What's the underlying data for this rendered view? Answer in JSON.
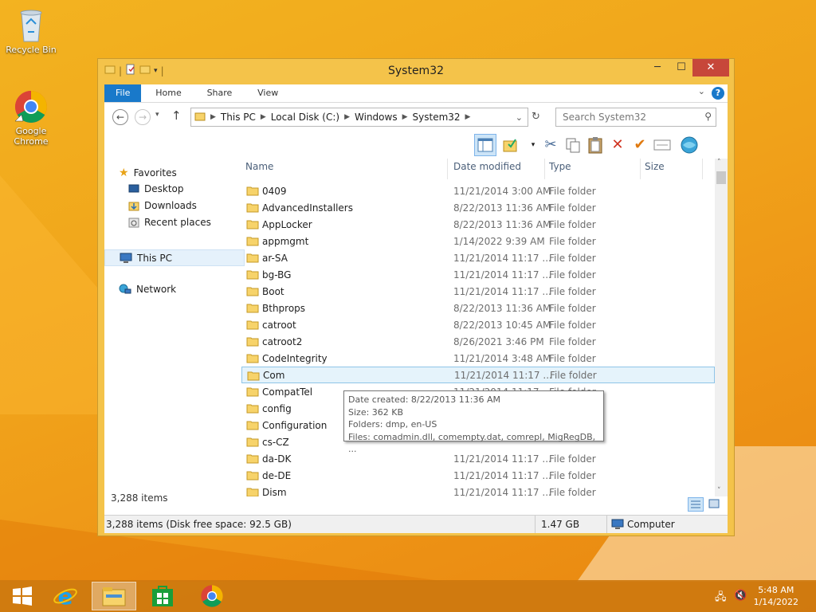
{
  "desktop": {
    "icons": [
      {
        "label": "Recycle Bin",
        "icon": "recycle-bin-icon"
      },
      {
        "label": "Google Chrome",
        "icon": "chrome-icon"
      }
    ]
  },
  "window": {
    "title": "System32",
    "controls": {
      "minimize": "─",
      "maximize": "☐",
      "close": "✕"
    },
    "ribbon_tabs": [
      {
        "label": "File",
        "active": true
      },
      {
        "label": "Home"
      },
      {
        "label": "Share"
      },
      {
        "label": "View"
      }
    ],
    "help_label": "?",
    "address": {
      "crumbs": [
        "This PC",
        "Local Disk (C:)",
        "Windows",
        "System32"
      ]
    },
    "search": {
      "placeholder": "Search System32"
    },
    "toolbar": [
      "preview-pane-icon",
      "folder-options-icon",
      "cut-icon",
      "copy-icon",
      "paste-icon",
      "delete-icon",
      "rename-icon",
      "properties-icon",
      "globe-icon"
    ],
    "navigation": {
      "favorites": "Favorites",
      "items": [
        "Desktop",
        "Downloads",
        "Recent places"
      ],
      "this_pc": "This PC",
      "network": "Network"
    },
    "columns": {
      "name": "Name",
      "date": "Date modified",
      "type": "Type",
      "size": "Size"
    },
    "files": [
      {
        "name": "0409",
        "date": "11/21/2014 3:00 AM",
        "type": "File folder"
      },
      {
        "name": "AdvancedInstallers",
        "date": "8/22/2013 11:36 AM",
        "type": "File folder"
      },
      {
        "name": "AppLocker",
        "date": "8/22/2013 11:36 AM",
        "type": "File folder"
      },
      {
        "name": "appmgmt",
        "date": "1/14/2022 9:39 AM",
        "type": "File folder"
      },
      {
        "name": "ar-SA",
        "date": "11/21/2014 11:17 ...",
        "type": "File folder"
      },
      {
        "name": "bg-BG",
        "date": "11/21/2014 11:17 ...",
        "type": "File folder"
      },
      {
        "name": "Boot",
        "date": "11/21/2014 11:17 ...",
        "type": "File folder"
      },
      {
        "name": "Bthprops",
        "date": "8/22/2013 11:36 AM",
        "type": "File folder"
      },
      {
        "name": "catroot",
        "date": "8/22/2013 10:45 AM",
        "type": "File folder"
      },
      {
        "name": "catroot2",
        "date": "8/26/2021 3:46 PM",
        "type": "File folder"
      },
      {
        "name": "CodeIntegrity",
        "date": "11/21/2014 3:48 AM",
        "type": "File folder"
      },
      {
        "name": "Com",
        "date": "11/21/2014 11:17 ...",
        "type": "File folder",
        "selected": true
      },
      {
        "name": "CompatTel",
        "date": "11/21/2014 11:17 ...",
        "type": "File folder"
      },
      {
        "name": "config",
        "date": "",
        "type": ""
      },
      {
        "name": "Configuration",
        "date": "",
        "type": ""
      },
      {
        "name": "cs-CZ",
        "date": "",
        "type": ""
      },
      {
        "name": "da-DK",
        "date": "11/21/2014 11:17 ...",
        "type": "File folder"
      },
      {
        "name": "de-DE",
        "date": "11/21/2014 11:17 ...",
        "type": "File folder"
      },
      {
        "name": "Dism",
        "date": "11/21/2014 11:17 ...",
        "type": "File folder"
      }
    ],
    "item_count": "3,288 items",
    "tooltip": {
      "line1": "Date created: 8/22/2013 11:36 AM",
      "line2": "Size: 362 KB",
      "line3": "Folders: dmp, en-US",
      "line4": "Files: comadmin.dll, comempty.dat, comrepl, MigRegDB, ..."
    },
    "statusbar": {
      "items": "3,288 items (Disk free space: 92.5 GB)",
      "size": "1.47 GB",
      "location": "Computer"
    }
  },
  "taskbar": {
    "apps": [
      "start-icon",
      "internet-explorer-icon",
      "file-explorer-icon",
      "store-icon",
      "chrome-icon"
    ],
    "time": "5:48 AM",
    "date": "1/14/2022"
  },
  "colors": {
    "accent": "#1979ca",
    "selection": "#e5f3fb",
    "window_frame": "#f4c34a"
  }
}
